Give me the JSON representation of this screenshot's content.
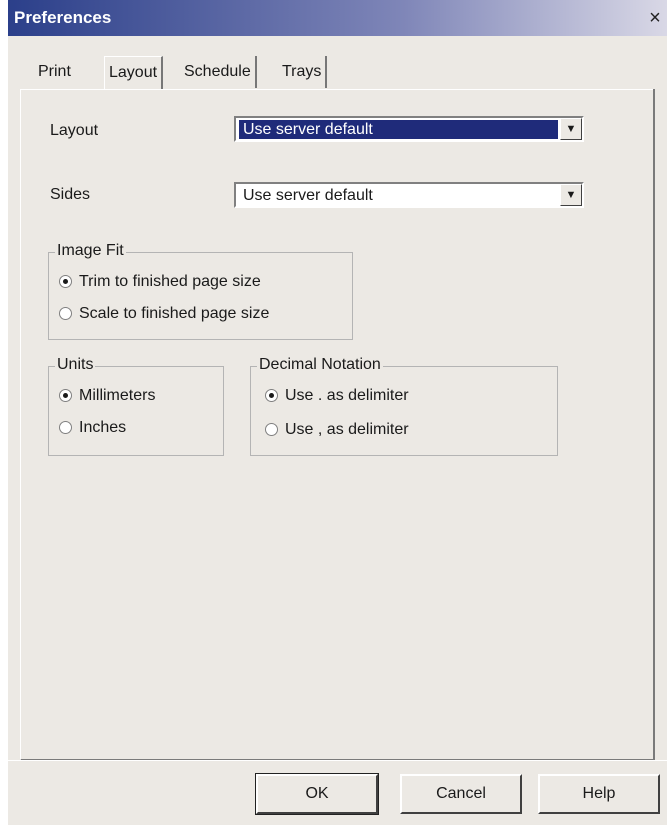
{
  "window": {
    "title": "Preferences",
    "close_glyph": "×"
  },
  "tabs": [
    {
      "label": "Print"
    },
    {
      "label": "Layout"
    },
    {
      "label": "Schedule"
    },
    {
      "label": "Trays"
    }
  ],
  "active_tab": "Layout",
  "layout_field": {
    "label": "Layout",
    "value": "Use server default"
  },
  "sides_field": {
    "label": "Sides",
    "value": "Use server default"
  },
  "image_fit": {
    "title": "Image Fit",
    "options": [
      {
        "label": "Trim to finished page size",
        "selected": true
      },
      {
        "label": "Scale to finished page size",
        "selected": false
      }
    ]
  },
  "units": {
    "title": "Units",
    "options": [
      {
        "label": "Millimeters",
        "selected": true
      },
      {
        "label": "Inches",
        "selected": false
      }
    ]
  },
  "decimal_notation": {
    "title": "Decimal Notation",
    "options": [
      {
        "label": "Use . as delimiter",
        "selected": true
      },
      {
        "label": "Use , as delimiter",
        "selected": false
      }
    ]
  },
  "buttons": {
    "ok": "OK",
    "cancel": "Cancel",
    "help": "Help"
  },
  "colors": {
    "titlebar": "#2b3f8a",
    "selection": "#1f2b7a",
    "dialog_bg": "#ece9e4"
  }
}
